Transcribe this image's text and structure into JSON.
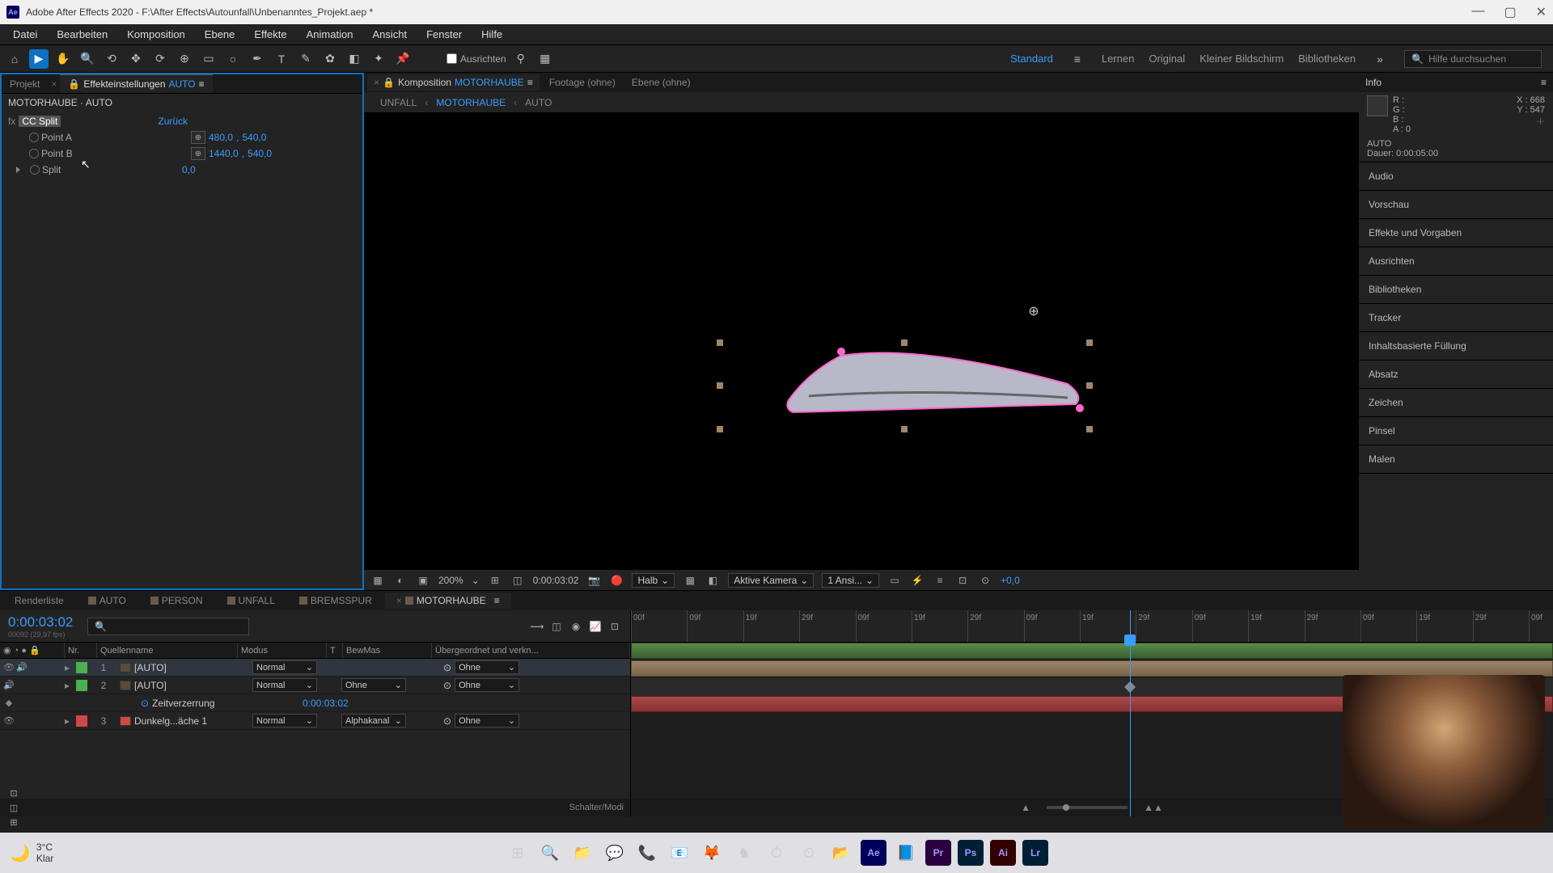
{
  "title": "Adobe After Effects 2020 - F:\\After Effects\\Autounfall\\Unbenanntes_Projekt.aep *",
  "menu": [
    "Datei",
    "Bearbeiten",
    "Komposition",
    "Ebene",
    "Effekte",
    "Animation",
    "Ansicht",
    "Fenster",
    "Hilfe"
  ],
  "toolbar": {
    "align_label": "Ausrichten",
    "workspaces": {
      "active": "Standard",
      "others": [
        "Lernen",
        "Original",
        "Kleiner Bildschirm",
        "Bibliotheken"
      ]
    },
    "search_placeholder": "Hilfe durchsuchen"
  },
  "effects_panel": {
    "tab_project": "Projekt",
    "tab_fx": "Effekteinstellungen",
    "tab_fx_layer": "AUTO",
    "subheader": "MOTORHAUBE · AUTO",
    "effect": {
      "name": "CC Split",
      "reset": "Zurück",
      "props": {
        "point_a": {
          "label": "Point A",
          "x": "480,0",
          "y": "540,0"
        },
        "point_b": {
          "label": "Point B",
          "x": "1440,0",
          "y": "540,0"
        },
        "split": {
          "label": "Split",
          "value": "0,0"
        }
      }
    }
  },
  "viewer": {
    "tab_comp_prefix": "Komposition",
    "tab_comp_name": "MOTORHAUBE",
    "tab_footage": "Footage (ohne)",
    "tab_layer": "Ebene (ohne)",
    "flowchart": [
      "UNFALL",
      "MOTORHAUBE",
      "AUTO"
    ],
    "footer": {
      "zoom": "200%",
      "time": "0:00:03:02",
      "res": "Halb",
      "camera": "Aktive Kamera",
      "views": "1 Ansi...",
      "exposure": "+0,0"
    }
  },
  "info_panel": {
    "title": "Info",
    "rgba": {
      "R": "R :",
      "G": "G :",
      "B": "B :",
      "A": "A : 0"
    },
    "xy": {
      "X": "X : 668",
      "Y": "Y : 547"
    },
    "layer_name": "AUTO",
    "duration": "Dauer: 0:00:05:00"
  },
  "side_sections": [
    "Audio",
    "Vorschau",
    "Effekte und Vorgaben",
    "Ausrichten",
    "Bibliotheken",
    "Tracker",
    "Inhaltsbasierte Füllung",
    "Absatz",
    "Zeichen",
    "Pinsel",
    "Malen"
  ],
  "timeline": {
    "tabs": [
      {
        "label": "Renderliste",
        "square": false
      },
      {
        "label": "AUTO",
        "square": true
      },
      {
        "label": "PERSON",
        "square": true
      },
      {
        "label": "UNFALL",
        "square": true
      },
      {
        "label": "BREMSSPUR",
        "square": true
      },
      {
        "label": "MOTORHAUBE",
        "square": true,
        "active": true
      }
    ],
    "timecode": "0:00:03:02",
    "timecode_sub": "00092 (29,97 fps)",
    "cols": {
      "nr": "Nr.",
      "source": "Quellenname",
      "mode": "Modus",
      "t": "T",
      "trkmat": "BewMas",
      "parent": "Übergeordnet und verkn..."
    },
    "layers": [
      {
        "nr": "1",
        "name": "AUTO",
        "mode": "Normal",
        "trk": "",
        "parent": "Ohne",
        "color": "#4caf50",
        "sel": true,
        "precomp": true,
        "eye": true,
        "audio": true
      },
      {
        "nr": "2",
        "name": "AUTO",
        "mode": "Normal",
        "trk": "Ohne",
        "parent": "Ohne",
        "color": "#4caf50",
        "precomp": true,
        "audio": true
      },
      {
        "nr": "",
        "name": "Zeitverzerrung",
        "tw_value": "0:00:03:02",
        "indent": true,
        "keyframe": true
      },
      {
        "nr": "3",
        "name": "Dunkelg...äche 1",
        "mode": "Normal",
        "trk": "Alphakanal",
        "parent": "Ohne",
        "color": "#d04848",
        "solid": true,
        "eye": true
      }
    ],
    "ruler_ticks": [
      "00f",
      "09f",
      "19f",
      "29f",
      "09f",
      "19f",
      "29f",
      "09f",
      "19f",
      "29f",
      "09f",
      "19f",
      "29f",
      "09f",
      "19f",
      "29f",
      "09f"
    ],
    "footer_label": "Schalter/Modi"
  },
  "weather": {
    "temp": "3°C",
    "cond": "Klar"
  },
  "taskbar_apps": [
    "⊞",
    "🔍",
    "📁",
    "💬",
    "📞",
    "📧",
    "🦊",
    "♞",
    "⏱",
    "⏲",
    "📂",
    "Ae",
    "📘",
    "Pr",
    "Ps",
    "Ai",
    "Lr"
  ]
}
